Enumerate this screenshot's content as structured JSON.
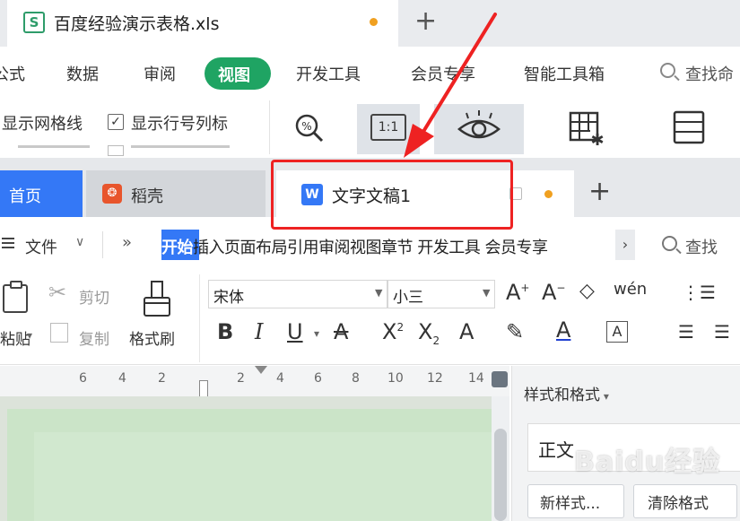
{
  "background_window": {
    "tab": {
      "title": "百度经验演示表格.xls",
      "icon": "spreadsheet-icon"
    },
    "new_tab_label": "+",
    "menu": [
      "公式",
      "数据",
      "审阅",
      "视图",
      "开发工具",
      "会员专享",
      "智能工具箱"
    ],
    "active_menu": "视图",
    "search_label": "查找命",
    "options": {
      "gridlines_label": "显示网格线",
      "headers_label": "显示行号列标",
      "headers_checked": true
    },
    "tools": [
      "zoom-icon",
      "actual-size-icon",
      "eye-protection-icon",
      "freeze-panes-icon",
      "split-window-icon"
    ],
    "actual_size_label": "1:1"
  },
  "writer": {
    "tabs": [
      {
        "label": "首页",
        "active": false
      },
      {
        "label": "稻壳",
        "active": false
      },
      {
        "label": "文字文稿1",
        "active": true,
        "unsaved": true
      }
    ],
    "new_tab_label": "+",
    "file_menu_label": "文件",
    "more_label": "»",
    "ribbon_tabs": [
      "开始",
      "插入",
      "页面布局",
      "引用",
      "审阅",
      "视图",
      "章节",
      " 开发工具",
      " 会员专享"
    ],
    "selected_ribbon_tab": "开始",
    "scroll_right_label": "›",
    "search_label": "查找",
    "clipboard": {
      "paste_label": "粘贴",
      "cut_label": "剪切",
      "copy_label": "复制",
      "format_painter_label": "格式刷"
    },
    "font": {
      "name": "宋体",
      "size": "小三"
    },
    "ruler_marks": [
      "6",
      "4",
      "2",
      "2",
      "4",
      "6",
      "8",
      "10",
      "12",
      "14"
    ],
    "side_panel": {
      "title": "样式和格式",
      "current_style": "正文",
      "new_style_label": "新样式...",
      "clear_format_label": "清除格式"
    }
  },
  "annotation": {
    "highlight_color": "#ee2222"
  },
  "watermark": "Baidu经验",
  "colors": {
    "accent_blue": "#3478f6",
    "accent_green": "#1fa463",
    "unsaved_dot": "#f0a020"
  }
}
